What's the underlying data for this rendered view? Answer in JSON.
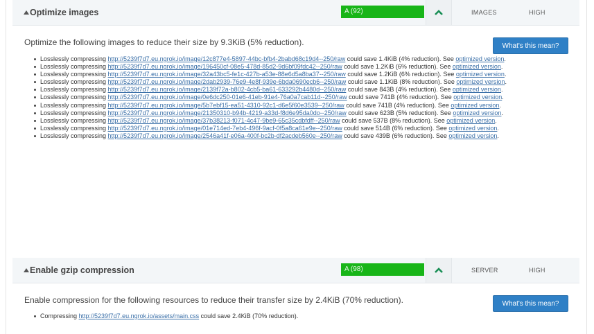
{
  "sections": [
    {
      "title": "Optimize images",
      "grade": "A (92)",
      "category": "IMAGES",
      "priority": "HIGH",
      "summary": "Optimize the following images to reduce their size by 9.3KiB (5% reduction).",
      "button_label": "What's this mean?",
      "items": [
        {
          "prefix": "Losslessly compressing ",
          "url": "http://5239f7d7.eu.ngrok.io/image/12c877e4-5897-44bc-bfb4-2babd68c19d4--250/raw",
          "middle": " could save 1.4KiB (4% reduction). See ",
          "link": "optimized version",
          "end": "."
        },
        {
          "prefix": "Losslessly compressing ",
          "url": "http://5239f7d7.eu.ngrok.io/image/196450cf-08e5-478d-85d2-9d6bf09fdc42--250/raw",
          "middle": " could save 1.2KiB (6% reduction). See ",
          "link": "optimized version",
          "end": "."
        },
        {
          "prefix": "Losslessly compressing ",
          "url": "http://5239f7d7.eu.ngrok.io/image/32a43bc5-fe1c-427b-a53e-88e6d5a8ba37--250/raw",
          "middle": " could save 1.2KiB (6% reduction). See ",
          "link": "optimized version",
          "end": "."
        },
        {
          "prefix": "Losslessly compressing ",
          "url": "http://5239f7d7.eu.ngrok.io/image/2dab2939-76e9-4e8f-939e-6bda0690ecb6--250/raw",
          "middle": " could save 1.1KiB (8% reduction). See ",
          "link": "optimized version",
          "end": "."
        },
        {
          "prefix": "Losslessly compressing ",
          "url": "http://5239f7d7.eu.ngrok.io/image/2139f72a-b802-4cb5-ba61-633292b4480d--250/raw",
          "middle": " could save 843B (4% reduction). See ",
          "link": "optimized version",
          "end": "."
        },
        {
          "prefix": "Losslessly compressing ",
          "url": "http://5239f7d7.eu.ngrok.io/image/0e6dc250-01e6-41eb-91e4-76a0a7cab11d--250/raw",
          "middle": " could save 741B (4% reduction). See ",
          "link": "optimized version",
          "end": "."
        },
        {
          "prefix": "Losslessly compressing ",
          "url": "http://5239f7d7.eu.ngrok.io/image/5b7ebf15-ea51-4310-92c1-d6e5f60e3539--250/raw",
          "middle": " could save 741B (4% reduction). See ",
          "link": "optimized version",
          "end": "."
        },
        {
          "prefix": "Losslessly compressing ",
          "url": "http://5239f7d7.eu.ngrok.io/image/21350310-b94b-4219-a33d-f8d6e95da0do--250/raw",
          "middle": " could save 623B (5% reduction). See ",
          "link": "optimized version",
          "end": "."
        },
        {
          "prefix": "Losslessly compressing ",
          "url": "http://5239f7d7.eu.ngrok.io/image/37b38213-f071-4c47-9be9-65c35cdbfdff--250/raw",
          "middle": " could save 537B (8% reduction). See ",
          "link": "optimized version",
          "end": "."
        },
        {
          "prefix": "Losslessly compressing ",
          "url": "http://5239f7d7.eu.ngrok.io/image/01e714ed-7eb4-496f-9acf-0f5a8ca61e9e--250/raw",
          "middle": " could save 514B (6% reduction). See ",
          "link": "optimized version",
          "end": "."
        },
        {
          "prefix": "Losslessly compressing ",
          "url": "http://5239f7d7.eu.ngrok.io/image/2546a41f-e06a-400f-bc2b-df2acdeb560e--250/raw",
          "middle": " could save 439B (6% reduction). See ",
          "link": "optimized version",
          "end": "."
        }
      ]
    },
    {
      "title": "Enable gzip compression",
      "grade": "A (98)",
      "category": "SERVER",
      "priority": "HIGH",
      "summary": "Enable compression for the following resources to reduce their transfer size by 2.4KiB (70% reduction).",
      "button_label": "What's this mean?",
      "items": [
        {
          "prefix": "Compressing ",
          "url": "http://5239f7d7.eu.ngrok.io/assets/main.css",
          "middle": " could save 2.4KiB (70% reduction).",
          "link": "",
          "end": ""
        }
      ]
    }
  ],
  "colors": {
    "grade_green": "#18b518",
    "button_blue": "#2f80c6",
    "link_blue": "#3a6fa8",
    "header_bg": "#f3f6f8"
  },
  "icons": {
    "expand": "triangle-up-icon",
    "collapse": "chevron-up-icon"
  }
}
